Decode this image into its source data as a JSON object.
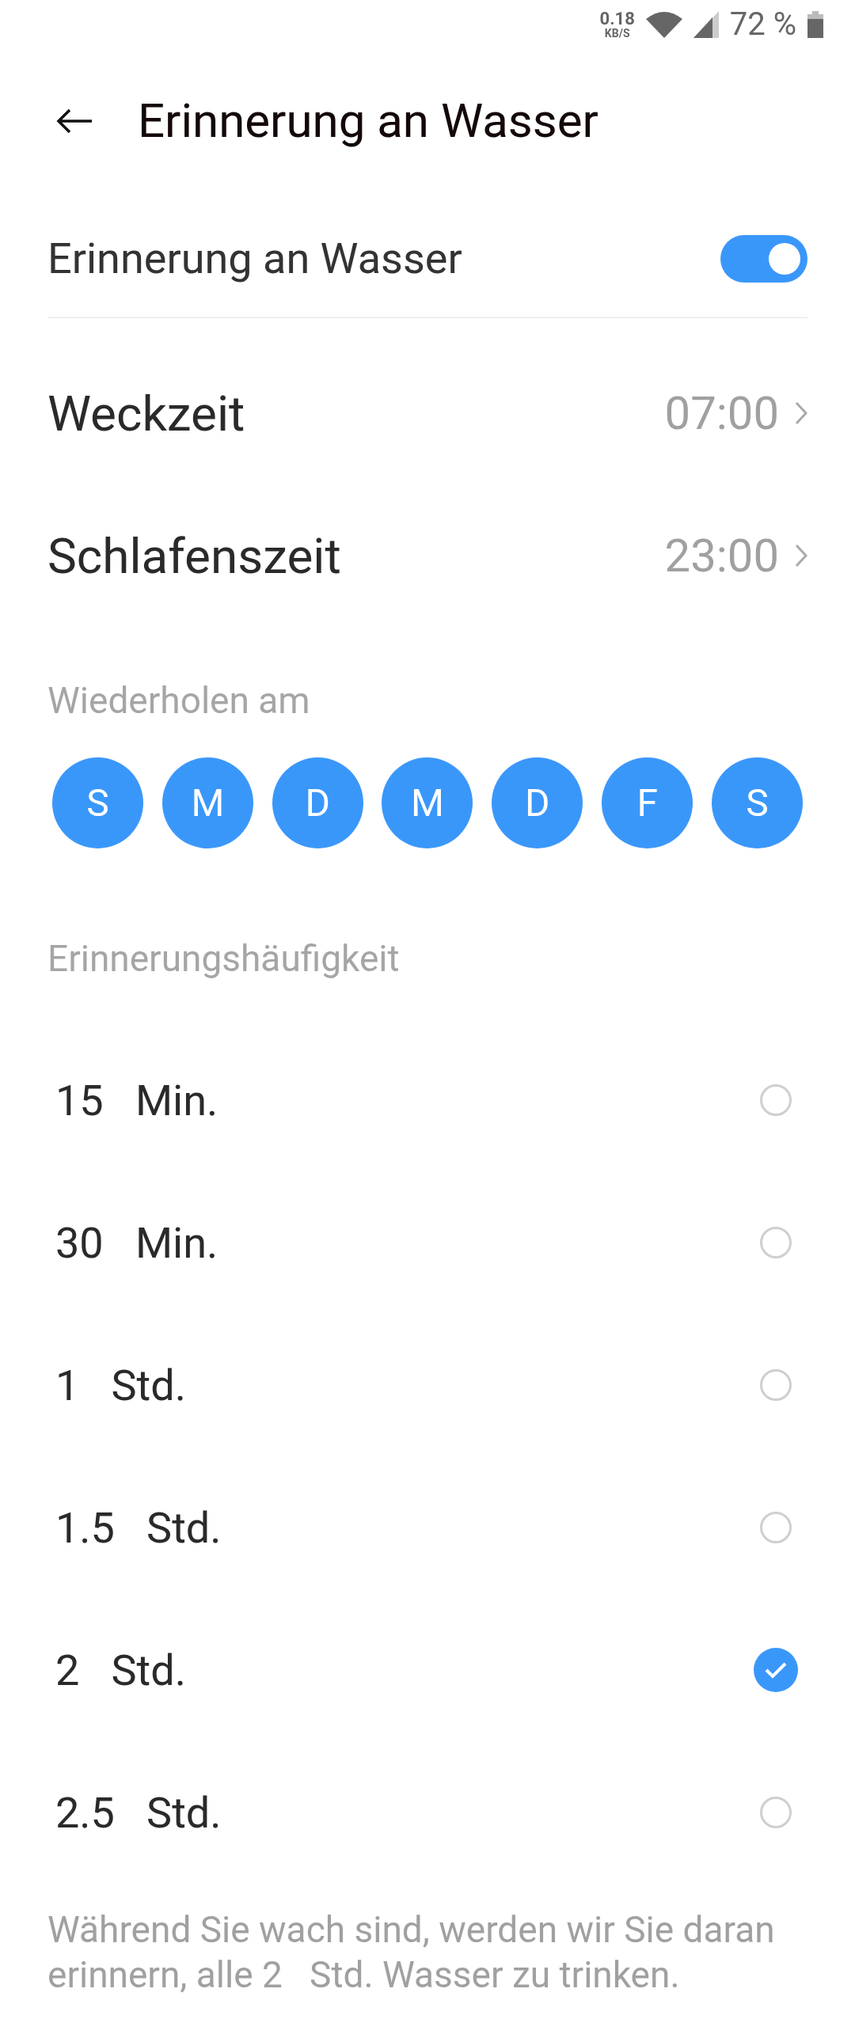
{
  "status_bar": {
    "speed": "0.18",
    "speed_unit": "KB/S",
    "battery": "72 %"
  },
  "header": {
    "title": "Erinnerung an Wasser"
  },
  "reminder": {
    "label": "Erinnerung an Wasser",
    "on": true
  },
  "times": [
    {
      "label": "Weckzeit",
      "value": "07:00"
    },
    {
      "label": "Schlafenszeit",
      "value": "23:00"
    }
  ],
  "repeat": {
    "heading": "Wiederholen am",
    "days": [
      {
        "label": "S",
        "selected": true
      },
      {
        "label": "M",
        "selected": true
      },
      {
        "label": "D",
        "selected": true
      },
      {
        "label": "M",
        "selected": true
      },
      {
        "label": "D",
        "selected": true
      },
      {
        "label": "F",
        "selected": true
      },
      {
        "label": "S",
        "selected": true
      }
    ]
  },
  "frequency": {
    "heading": "Erinnerungshäufigkeit",
    "options": [
      {
        "label": "15   Min.",
        "selected": false
      },
      {
        "label": "30   Min.",
        "selected": false
      },
      {
        "label": "1   Std.",
        "selected": false
      },
      {
        "label": "1.5   Std.",
        "selected": false
      },
      {
        "label": "2   Std.",
        "selected": true
      },
      {
        "label": "2.5   Std.",
        "selected": false
      }
    ]
  },
  "footer": "Während Sie wach sind, werden wir Sie daran erinnern, alle 2   Std. Wasser zu trinken."
}
